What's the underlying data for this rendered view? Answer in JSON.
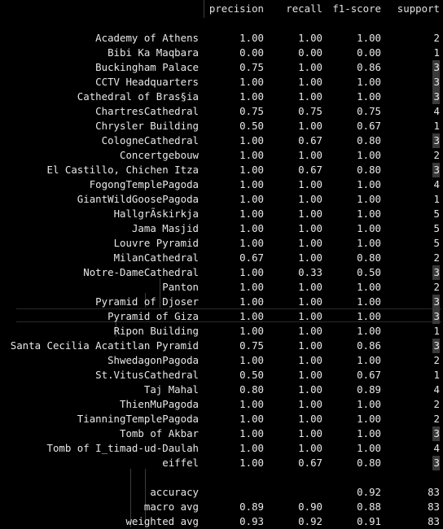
{
  "header": {
    "precision": "precision",
    "recall": "recall",
    "f1": "f1-score",
    "support": "support"
  },
  "rows": [
    {
      "label": "Academy of Athens",
      "precision": "1.00",
      "recall": "1.00",
      "f1": "1.00",
      "support": "2",
      "hl": false
    },
    {
      "label": "Bibi Ka Maqbara",
      "precision": "0.00",
      "recall": "0.00",
      "f1": "0.00",
      "support": "1",
      "hl": false
    },
    {
      "label": "Buckingham Palace",
      "precision": "0.75",
      "recall": "1.00",
      "f1": "0.86",
      "support": "3",
      "hl": true
    },
    {
      "label": "CCTV Headquarters",
      "precision": "1.00",
      "recall": "1.00",
      "f1": "1.00",
      "support": "3",
      "hl": true
    },
    {
      "label": "Cathedral of Bras§ia",
      "precision": "1.00",
      "recall": "1.00",
      "f1": "1.00",
      "support": "3",
      "hl": true
    },
    {
      "label": "ChartresCathedral",
      "precision": "0.75",
      "recall": "0.75",
      "f1": "0.75",
      "support": "4",
      "hl": false
    },
    {
      "label": "Chrysler Building",
      "precision": "0.50",
      "recall": "1.00",
      "f1": "0.67",
      "support": "1",
      "hl": false
    },
    {
      "label": "CologneCathedral",
      "precision": "1.00",
      "recall": "0.67",
      "f1": "0.80",
      "support": "3",
      "hl": true
    },
    {
      "label": "Concertgebouw",
      "precision": "1.00",
      "recall": "1.00",
      "f1": "1.00",
      "support": "2",
      "hl": false
    },
    {
      "label": "El Castillo, Chichen Itza",
      "precision": "1.00",
      "recall": "0.67",
      "f1": "0.80",
      "support": "3",
      "hl": true
    },
    {
      "label": "FogongTemplePagoda",
      "precision": "1.00",
      "recall": "1.00",
      "f1": "1.00",
      "support": "4",
      "hl": false
    },
    {
      "label": "GiantWildGoosePagoda",
      "precision": "1.00",
      "recall": "1.00",
      "f1": "1.00",
      "support": "1",
      "hl": false
    },
    {
      "label": "HallgrÃ­skirkja",
      "precision": "1.00",
      "recall": "1.00",
      "f1": "1.00",
      "support": "5",
      "hl": false
    },
    {
      "label": "Jama Masjid",
      "precision": "1.00",
      "recall": "1.00",
      "f1": "1.00",
      "support": "5",
      "hl": false
    },
    {
      "label": "Louvre Pyramid",
      "precision": "1.00",
      "recall": "1.00",
      "f1": "1.00",
      "support": "5",
      "hl": false
    },
    {
      "label": "MilanCathedral",
      "precision": "0.67",
      "recall": "1.00",
      "f1": "0.80",
      "support": "2",
      "hl": false
    },
    {
      "label": "Notre-DameCathedral",
      "precision": "1.00",
      "recall": "0.33",
      "f1": "0.50",
      "support": "3",
      "hl": true
    },
    {
      "label": "Panton",
      "precision": "1.00",
      "recall": "1.00",
      "f1": "1.00",
      "support": "2",
      "hl": false
    },
    {
      "label": "Pyramid of Djoser",
      "precision": "1.00",
      "recall": "1.00",
      "f1": "1.00",
      "support": "3",
      "hl": true
    },
    {
      "label": "Pyramid of Giza",
      "precision": "1.00",
      "recall": "1.00",
      "f1": "1.00",
      "support": "3",
      "hl": true
    },
    {
      "label": "Ripon Building",
      "precision": "1.00",
      "recall": "1.00",
      "f1": "1.00",
      "support": "1",
      "hl": false
    },
    {
      "label": "Santa Cecilia Acatitlan Pyramid",
      "precision": "0.75",
      "recall": "1.00",
      "f1": "0.86",
      "support": "3",
      "hl": true
    },
    {
      "label": "ShwedagonPagoda",
      "precision": "1.00",
      "recall": "1.00",
      "f1": "1.00",
      "support": "2",
      "hl": false
    },
    {
      "label": "St.VitusCathedral",
      "precision": "0.50",
      "recall": "1.00",
      "f1": "0.67",
      "support": "1",
      "hl": false
    },
    {
      "label": "Taj Mahal",
      "precision": "0.80",
      "recall": "1.00",
      "f1": "0.89",
      "support": "4",
      "hl": false
    },
    {
      "label": "ThienMuPagoda",
      "precision": "1.00",
      "recall": "1.00",
      "f1": "1.00",
      "support": "2",
      "hl": false
    },
    {
      "label": "TianningTemplePagoda",
      "precision": "1.00",
      "recall": "1.00",
      "f1": "1.00",
      "support": "2",
      "hl": false
    },
    {
      "label": "Tomb of Akbar",
      "precision": "1.00",
      "recall": "1.00",
      "f1": "1.00",
      "support": "3",
      "hl": true
    },
    {
      "label": "Tomb of I_timad-ud-Daulah",
      "precision": "1.00",
      "recall": "1.00",
      "f1": "1.00",
      "support": "4",
      "hl": false
    },
    {
      "label": "eiffel",
      "precision": "1.00",
      "recall": "0.67",
      "f1": "0.80",
      "support": "3",
      "hl": true
    }
  ],
  "summary": [
    {
      "label": "accuracy",
      "precision": "",
      "recall": "",
      "f1": "0.92",
      "support": "83"
    },
    {
      "label": "macro avg",
      "precision": "0.89",
      "recall": "0.90",
      "f1": "0.88",
      "support": "83"
    },
    {
      "label": "weighted avg",
      "precision": "0.93",
      "recall": "0.92",
      "f1": "0.91",
      "support": "83"
    }
  ],
  "colors": {
    "background": "#000000",
    "text": "#e8e8e8",
    "highlight": "#3a3a3a",
    "indent_guide": "#3c3c3c"
  }
}
